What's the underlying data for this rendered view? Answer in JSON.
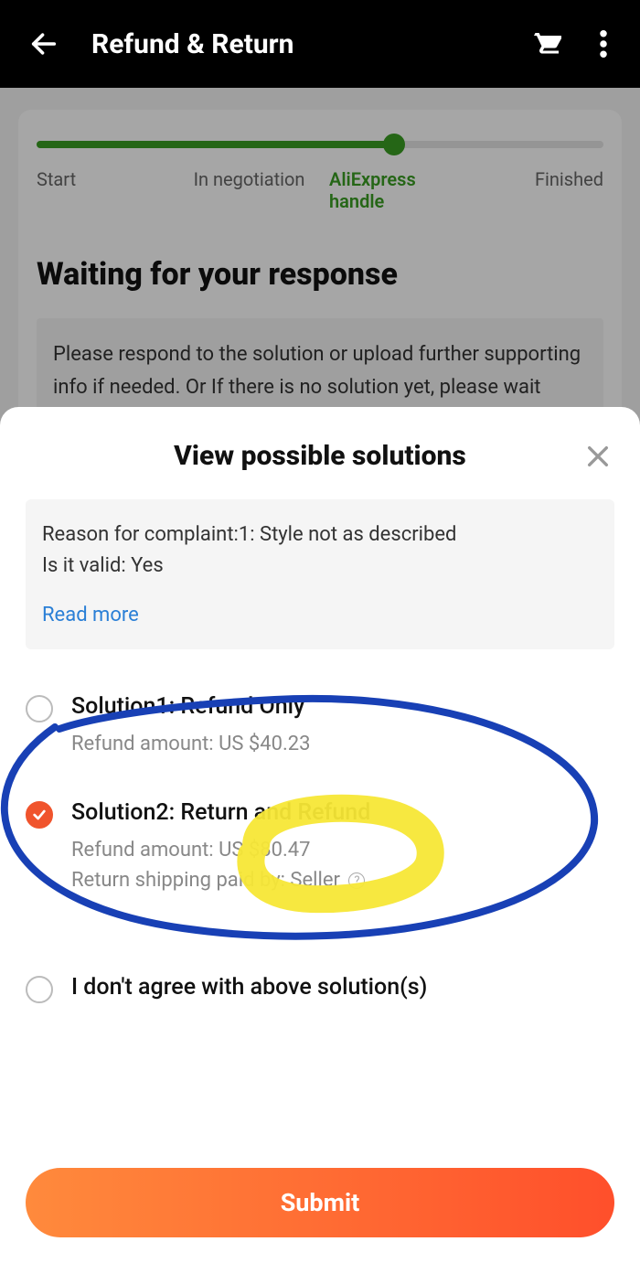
{
  "header": {
    "title": "Refund & Return"
  },
  "progress": {
    "steps": [
      "Start",
      "In negotiation",
      "AliExpress handle",
      "Finished"
    ]
  },
  "main": {
    "heading": "Waiting for your response",
    "notice": "Please respond to the solution or upload further supporting info if needed. Or If there is no solution yet, please wait patciently as AliExpress is still checking your order."
  },
  "sheet": {
    "title": "View possible solutions",
    "reason_line1": "Reason for complaint:1: Style not as described",
    "reason_line2": "Is it valid: Yes",
    "read_more": "Read more",
    "option1": {
      "title": "Solution1: Refund Only",
      "amount": "Refund amount: US $40.23"
    },
    "option2": {
      "title": "Solution2: Return and Refund",
      "amount": "Refund amount: US $80.47",
      "shipping_prefix": "Return shipping paid by: ",
      "shipping_by": "Seller"
    },
    "option3": {
      "title": "I don't agree with above solution(s)"
    },
    "submit": "Submit"
  }
}
